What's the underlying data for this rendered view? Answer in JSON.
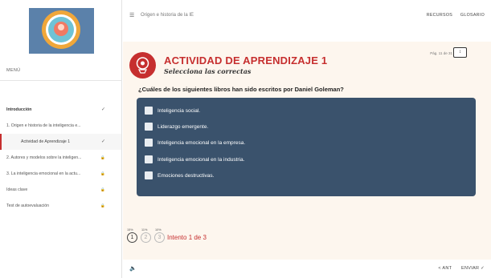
{
  "sidebar": {
    "menu_title": "MENÚ",
    "items": [
      {
        "label": "Introducción",
        "mark": "✓",
        "bold": true
      },
      {
        "label": "1. Origen e historia de la inteligencia e...",
        "mark": ""
      },
      {
        "label": "Actividad de Aprendizaje 1",
        "mark": "✓"
      },
      {
        "label": "2. Autores y modelos sobre la inteligen...",
        "mark": "🔒"
      },
      {
        "label": "3. La inteligencia emocional en la actu...",
        "mark": "🔒"
      },
      {
        "label": "Ideas clave",
        "mark": "🔒"
      },
      {
        "label": "Test de autoevaluación",
        "mark": "🔒"
      }
    ]
  },
  "header": {
    "menu_icon": "hamburger-icon",
    "breadcrumb": "Origen e historia de la IE",
    "links": [
      "RECURSOS",
      "GLOSARIO"
    ]
  },
  "activity": {
    "title": "ACTIVIDAD DE APRENDIZAJE 1",
    "subtitle": "Selecciona las correctas",
    "page": "Pág. 11 de 31",
    "page_badge": "↕",
    "question": "¿Cuáles de los siguientes libros han sido escritos por Daniel Goleman?",
    "options": [
      "Inteligencia social.",
      "Liderazgo emergente.",
      "Inteligencia emocional en la empresa.",
      "Inteligencia emocional en la industria.",
      "Emociones destructivas."
    ],
    "attempts": [
      {
        "num": "1",
        "pct": "15%"
      },
      {
        "num": "2",
        "pct": "11%"
      },
      {
        "num": "3",
        "pct": "10%"
      }
    ],
    "attempt_text": "Intento 1 de 3"
  },
  "footer": {
    "sound_icon": "speaker-icon",
    "prev": "< ANT",
    "next": "ENVIAR ✓"
  },
  "colors": {
    "accent": "#c62f2f",
    "question_box": "#3a526c",
    "content_bg": "#fdf6ee"
  }
}
